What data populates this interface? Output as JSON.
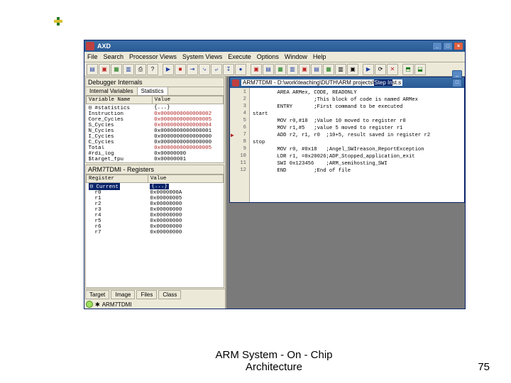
{
  "app": {
    "title": "AXD"
  },
  "menu": [
    "File",
    "Search",
    "Processor Views",
    "System Views",
    "Execute",
    "Options",
    "Window",
    "Help"
  ],
  "internals_panel": {
    "title": "Debugger Internals",
    "tabs": [
      "Internal Variables",
      "Statistics"
    ],
    "active_tab": 1,
    "col_var": "Variable Name",
    "col_val": "Value",
    "rows": [
      {
        "name": "⊟ #statistics",
        "val": "{...}",
        "cls": "r-blk"
      },
      {
        "name": "  Instruction",
        "val": "0x0000000000000002",
        "cls": "r-red"
      },
      {
        "name": "  Core_Cycles",
        "val": "0x0000000000000005",
        "cls": "r-red"
      },
      {
        "name": "  S_Cycles",
        "val": "0x0000000000000004",
        "cls": "r-red"
      },
      {
        "name": "  N_Cycles",
        "val": "0x0000000000000001",
        "cls": "r-blk"
      },
      {
        "name": "  I_Cycles",
        "val": "0x0000000000000000",
        "cls": "r-blk"
      },
      {
        "name": "  C_Cycles",
        "val": "0x0000000000000000",
        "cls": "r-blk"
      },
      {
        "name": "  Total",
        "val": "0x0000000000000005",
        "cls": "r-red"
      },
      {
        "name": "#rdi_log",
        "val": "0x00000000",
        "cls": "r-blk"
      },
      {
        "name": "$target_fpu",
        "val": "0x00000001",
        "cls": "r-blk"
      }
    ]
  },
  "registers_panel": {
    "title": "ARM7TDMI - Registers",
    "col_reg": "Register",
    "col_val": "Value",
    "current_label": "Current",
    "current_val": "{...}",
    "regs": [
      {
        "n": "r0",
        "v": "0x0000000A"
      },
      {
        "n": "r1",
        "v": "0x00000005"
      },
      {
        "n": "r2",
        "v": "0x00000000"
      },
      {
        "n": "r3",
        "v": "0x00000000"
      },
      {
        "n": "r4",
        "v": "0x00000000"
      },
      {
        "n": "r5",
        "v": "0x00000000"
      },
      {
        "n": "r6",
        "v": "0x00000000"
      },
      {
        "n": "r7",
        "v": "0x00000000"
      }
    ]
  },
  "bottom_tabs": [
    "Target",
    "Image",
    "Files",
    "Class"
  ],
  "processor_name": "ARM7TDMI",
  "code_window": {
    "prefix": "ARM7TDMI - D:\\work\\teaching\\DUTH\\ARM projects\\",
    "sel": "Step In",
    "suffix": "st.s",
    "lines": [
      "        AREA ARMex, CODE, READONLY",
      "                    ;This block of code is named ARMex",
      "        ENTRY       ;First command to be executed",
      "start",
      "        MOV r0,#10  ;Value 10 moved to register r0",
      "        MOV r1,#5   ;value 5 moved to register r1",
      "        ADD r2, r1, r0  ;10+5, result saved in register r2",
      "stop",
      "        MOV r0, #0x18   ;Angel_SWIreason_ReportException",
      "        LDR r1, =0x20026;ADP_Stopped_application_exit",
      "        SWI 0x123456    ;ARM_semihosting_SWI",
      "        END         ;End of file"
    ],
    "arrow_line": 7
  },
  "footer": {
    "l1": "ARM      System - On - Chip",
    "l2": "Architecture"
  },
  "page_number": "75"
}
